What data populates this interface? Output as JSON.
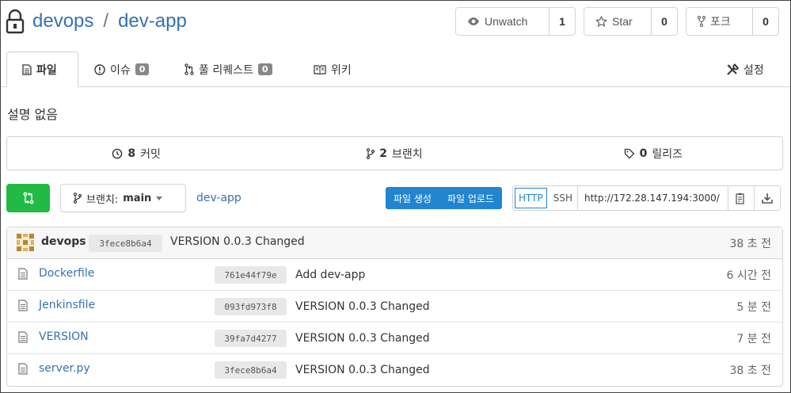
{
  "repo": {
    "owner": "devops",
    "separator": "/",
    "name": "dev-app"
  },
  "actions": {
    "watch": {
      "label": "Unwatch",
      "count": "1"
    },
    "star": {
      "label": "Star",
      "count": "0"
    },
    "fork": {
      "label": "포크",
      "count": "0"
    }
  },
  "tabs": [
    {
      "label": "파일",
      "icon": "file-icon",
      "active": true
    },
    {
      "label": "이슈",
      "badge": "0",
      "icon": "issue-icon"
    },
    {
      "label": "풀 리퀘스트",
      "badge": "0",
      "icon": "pull-request-icon"
    },
    {
      "label": "위키",
      "icon": "book-icon"
    },
    {
      "label": "설정",
      "icon": "tools-icon"
    }
  ],
  "description": "설명 없음",
  "stats": {
    "commits": {
      "count": "8",
      "label": "커밋"
    },
    "branches": {
      "count": "2",
      "label": "브랜치"
    },
    "releases": {
      "count": "0",
      "label": "릴리즈"
    }
  },
  "toolbar": {
    "branch_prefix": "브랜치:",
    "branch": "main",
    "breadcrumb": "dev-app",
    "new_file": "파일 생성",
    "upload_file": "파일 업로드",
    "protocol_http": "HTTP",
    "protocol_ssh": "SSH",
    "clone_url": "http://172.28.147.194:3000/"
  },
  "latest_commit": {
    "author": "devops",
    "sha": "3fece8b6a4",
    "message": "VERSION 0.0.3 Changed",
    "time": "38 초 전"
  },
  "files": [
    {
      "name": "Dockerfile",
      "sha": "761e44f79e",
      "message": "Add dev-app",
      "time": "6 시간 전"
    },
    {
      "name": "Jenkinsfile",
      "sha": "093fd973f8",
      "message": "VERSION 0.0.3 Changed",
      "time": "5 분 전"
    },
    {
      "name": "VERSION",
      "sha": "39fa7d4277",
      "message": "VERSION 0.0.3 Changed",
      "time": "7 분 전"
    },
    {
      "name": "server.py",
      "sha": "3fece8b6a4",
      "message": "VERSION 0.0.3 Changed",
      "time": "38 초 전"
    }
  ],
  "colors": {
    "link": "#3572b0",
    "primary": "#2185d0",
    "green": "#21ba45"
  }
}
